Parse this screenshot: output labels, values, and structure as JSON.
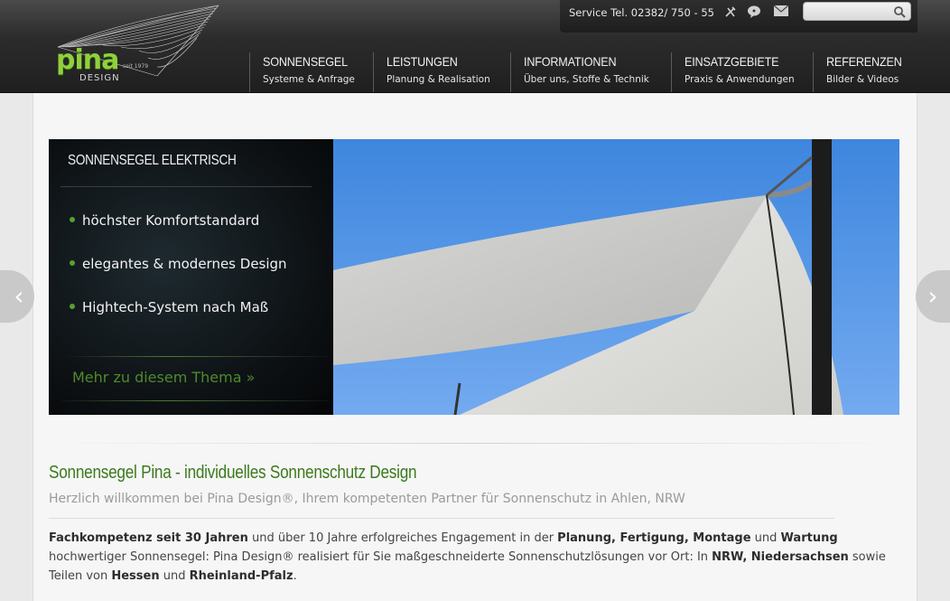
{
  "header": {
    "service_text": "Service Tel. 02382/ 750 - 55",
    "search": {
      "placeholder": ""
    },
    "logo": {
      "brand": "pina",
      "since": "seit 1979",
      "design": "DESIGN"
    },
    "nav": [
      {
        "title": "SONNENSEGEL",
        "subtitle": "Systeme & Anfrage"
      },
      {
        "title": "LEISTUNGEN",
        "subtitle": "Planung & Realisation"
      },
      {
        "title": "INFORMATIONEN",
        "subtitle": "Über uns, Stoffe & Technik"
      },
      {
        "title": "EINSATZGEBIETE",
        "subtitle": "Praxis & Anwendungen"
      },
      {
        "title": "REFERENZEN",
        "subtitle": "Bilder & Videos"
      }
    ]
  },
  "slider": {
    "title": "SONNENSEGEL ELEKTRISCH",
    "bullets": [
      "höchster Komfortstandard",
      "elegantes & modernes Design",
      "Hightech-System nach Maß"
    ],
    "more_link": "Mehr zu diesem Thema »",
    "prev_arrow": "‹",
    "next_arrow": "›"
  },
  "content": {
    "headline": "Sonnensegel Pina - individuelles Sonnenschutz Design",
    "subline": "Herzlich willkommen bei Pina Design®, Ihrem kompetenten Partner für Sonnenschutz in Ahlen, NRW",
    "paragraph": [
      {
        "text": "Fachkompetenz seit 30 Jahren",
        "bold": true
      },
      {
        "text": " und über 10 Jahre erfolgreiches Engagement in der ",
        "bold": false
      },
      {
        "text": "Planung, Fertigung, Montage",
        "bold": true
      },
      {
        "text": " und ",
        "bold": false
      },
      {
        "text": "Wartung",
        "bold": true
      },
      {
        "text": " hochwertiger Sonnensegel: Pina Design® realisiert für Sie maßgeschneiderte Sonnenschutzlösungen vor Ort: In ",
        "bold": false
      },
      {
        "text": "NRW, Niedersachsen",
        "bold": true
      },
      {
        "text": " sowie Teilen von ",
        "bold": false
      },
      {
        "text": "Hessen",
        "bold": true
      },
      {
        "text": " und ",
        "bold": false
      },
      {
        "text": "Rheinland-Pfalz",
        "bold": true
      },
      {
        "text": ".",
        "bold": false
      }
    ]
  },
  "colors": {
    "accent_green": "#3c7a1c",
    "logo_green": "#8fd13a",
    "header_dark": "#2c2c2c"
  },
  "icons": [
    "tools-icon",
    "chat-icon",
    "mail-icon",
    "search-icon"
  ]
}
